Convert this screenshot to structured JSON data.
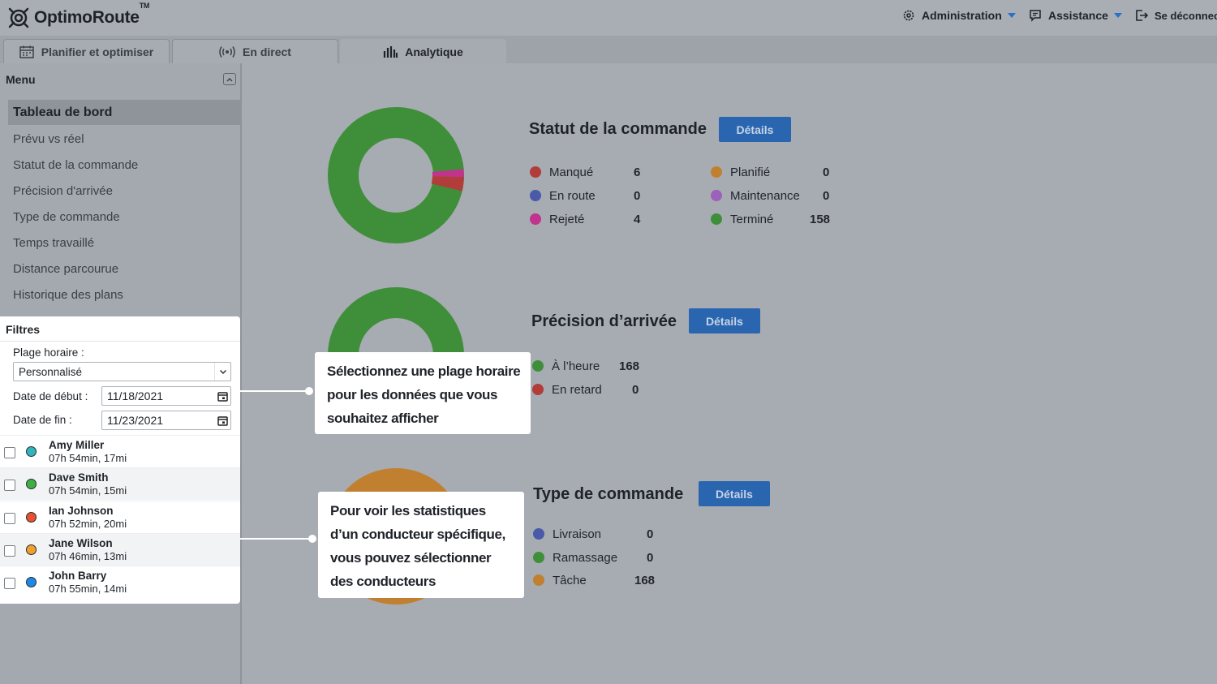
{
  "app": {
    "brand": "OptimoRoute",
    "trademark": "TM"
  },
  "header": {
    "administration": "Administration",
    "assistance": "Assistance",
    "logout": "Se déconnect"
  },
  "tabs": [
    {
      "label": "Planifier et optimiser",
      "icon": "calendar-icon"
    },
    {
      "label": "En direct",
      "icon": "broadcast-icon"
    },
    {
      "label": "Analytique",
      "icon": "bar-chart-icon",
      "active": true
    }
  ],
  "sidebar": {
    "menu_title": "Menu",
    "items": [
      {
        "label": "Tableau de bord",
        "active": true
      },
      {
        "label": "Prévu vs réel"
      },
      {
        "label": "Statut de la commande"
      },
      {
        "label": "Précision d'arrivée"
      },
      {
        "label": "Type de commande"
      },
      {
        "label": "Temps travaillé"
      },
      {
        "label": "Distance parcourue"
      },
      {
        "label": "Historique des plans"
      }
    ]
  },
  "filters": {
    "title": "Filtres",
    "time_range_label": "Plage horaire :",
    "time_range_value": "Personnalisé",
    "start_label": "Date de début :",
    "start_value": "11/18/2021",
    "end_label": "Date de fin :",
    "end_value": "11/23/2021",
    "drivers": [
      {
        "name": "Amy Miller",
        "meta": "07h 54min, 17mi",
        "color": "#2fb5ba"
      },
      {
        "name": "Dave Smith",
        "meta": "07h 54min, 15mi",
        "color": "#3cb043"
      },
      {
        "name": "Ian Johnson",
        "meta": "07h 52min, 20mi",
        "color": "#e8502f"
      },
      {
        "name": "Jane Wilson",
        "meta": "07h 46min, 13mi",
        "color": "#f0a030"
      },
      {
        "name": "John Barry",
        "meta": "07h 55min, 14mi",
        "color": "#1e88e5"
      }
    ]
  },
  "order_status": {
    "title": "Statut de la commande",
    "details": "Détails",
    "items": [
      {
        "label": "Manqué",
        "value": "6",
        "color": "#b23c3a"
      },
      {
        "label": "En route",
        "value": "0",
        "color": "#4a5aa8"
      },
      {
        "label": "Rejeté",
        "value": "4",
        "color": "#c0348e"
      },
      {
        "label": "Planifié",
        "value": "0",
        "color": "#c08030"
      },
      {
        "label": "Maintenance",
        "value": "0",
        "color": "#9a62b8"
      },
      {
        "label": "Terminé",
        "value": "158",
        "color": "#3f8f3a"
      }
    ]
  },
  "arrival_precision": {
    "title": "Précision d’arrivée",
    "details": "Détails",
    "items": [
      {
        "label": "À l’heure",
        "value": "168",
        "color": "#3f8f3a"
      },
      {
        "label": "En retard",
        "value": "0",
        "color": "#b23c3a"
      }
    ]
  },
  "order_type": {
    "title": "Type de commande",
    "details": "Détails",
    "items": [
      {
        "label": "Livraison",
        "value": "0",
        "color": "#4a5aa8"
      },
      {
        "label": "Ramassage",
        "value": "0",
        "color": "#3f8f3a"
      },
      {
        "label": "Tâche",
        "value": "168",
        "color": "#c08030"
      }
    ]
  },
  "callouts": {
    "time_range": "Sélectionnez une plage horaire pour les données que vous souhaitez afficher",
    "drivers": "Pour voir les statistiques d’un conducteur spécifique, vous pouvez sélectionner des conducteurs"
  },
  "colors": {
    "accent": "#2a66b0",
    "dim_background": "#a7abb2"
  }
}
